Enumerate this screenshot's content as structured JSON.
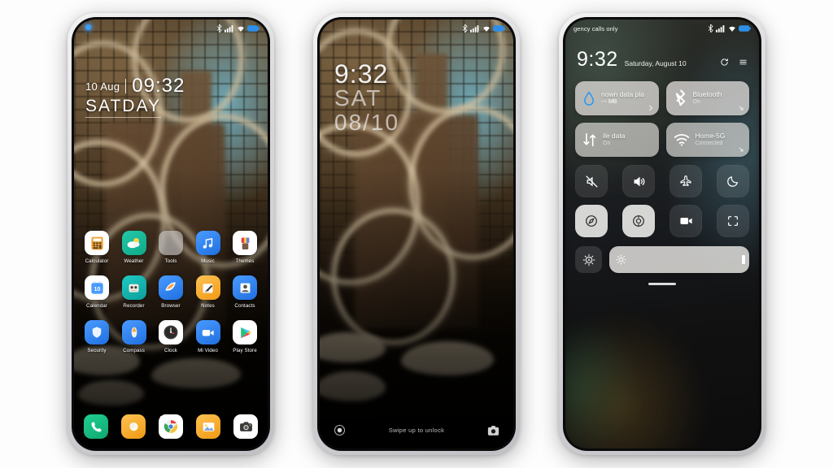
{
  "scene": {
    "background_color": "#ffffff",
    "phone_count": 3
  },
  "phone1_home": {
    "status_bar": {
      "left_text": "",
      "icons": [
        "bluetooth-icon",
        "signal-icon",
        "wifi-icon",
        "battery-icon"
      ]
    },
    "clock_widget": {
      "date": "10 Aug",
      "time": "09:32",
      "day": "SATDAY"
    },
    "app_rows": [
      [
        {
          "label": "Calculator",
          "icon": "calculator-icon",
          "bg": "#ffffff"
        },
        {
          "label": "Weather",
          "icon": "weather-icon",
          "bg": "#18b89a"
        },
        {
          "label": "Tools",
          "icon": "folder-icon",
          "bg": "#cdcdcd"
        },
        {
          "label": "Music",
          "icon": "music-icon",
          "bg": "#2e7ff0"
        },
        {
          "label": "Themes",
          "icon": "themes-icon",
          "bg": "#ffffff"
        }
      ],
      [
        {
          "label": "Calendar",
          "icon": "calendar-icon",
          "bg": "#ffffff"
        },
        {
          "label": "Recorder",
          "icon": "recorder-icon",
          "bg": "#15b7b0"
        },
        {
          "label": "Browser",
          "icon": "browser-icon",
          "bg": "#2e7ff0"
        },
        {
          "label": "Notes",
          "icon": "notes-icon",
          "bg": "#f5a623"
        },
        {
          "label": "Contacts",
          "icon": "contacts-icon",
          "bg": "#2e7ff0"
        }
      ],
      [
        {
          "label": "Security",
          "icon": "shield-icon",
          "bg": "#2e7ff0"
        },
        {
          "label": "Compass",
          "icon": "compass-icon",
          "bg": "#2e7ff0"
        },
        {
          "label": "Clock",
          "icon": "clock-icon",
          "bg": "#ffffff"
        },
        {
          "label": "Mi Video",
          "icon": "video-icon",
          "bg": "#2e7ff0"
        },
        {
          "label": "Play Store",
          "icon": "play-store-icon",
          "bg": "#ffffff"
        }
      ]
    ],
    "page_dots": {
      "count": 3,
      "active_index": 0
    },
    "dock": [
      {
        "label": "Phone",
        "icon": "phone-icon",
        "bg": "#17b980"
      },
      {
        "label": "Messages",
        "icon": "messages-icon",
        "bg": "#f5a623"
      },
      {
        "label": "Chrome",
        "icon": "chrome-icon",
        "bg": "#ffffff"
      },
      {
        "label": "Gallery",
        "icon": "gallery-icon",
        "bg": "#f5a623"
      },
      {
        "label": "Camera",
        "icon": "camera-icon",
        "bg": "#ffffff"
      }
    ]
  },
  "phone2_lock": {
    "status_bar": {
      "icons": [
        "bluetooth-icon",
        "signal-icon",
        "wifi-icon",
        "battery-icon"
      ]
    },
    "clock": {
      "time": "9:32",
      "day": "SAT",
      "date": "08/10"
    },
    "bottom": {
      "left_icon": "record-circle-icon",
      "hint": "Swipe up to unlock",
      "right_icon": "camera-icon"
    }
  },
  "phone3_control_center": {
    "status_bar": {
      "carrier": "gency calls only",
      "icons": [
        "bluetooth-icon",
        "signal-icon",
        "wifi-icon",
        "battery-icon"
      ]
    },
    "header": {
      "time": "9:32",
      "date": "Saturday, August 10",
      "refresh_icon": "refresh-icon",
      "menu_icon": "menu-icon"
    },
    "big_tiles": [
      {
        "icon": "data-drop-icon",
        "title": "nown data pla",
        "subtitle": "--- MB",
        "accent": "#2196f3",
        "expand": "chevron-right-icon"
      },
      {
        "icon": "bluetooth-icon",
        "title": "Bluetooth",
        "subtitle": "On",
        "accent": "#ffffff",
        "expand": "expand-arrow-icon"
      }
    ],
    "mid_tiles": [
      {
        "icon": "mobile-data-icon",
        "title": "ile data",
        "subtitle": "On",
        "accent": "#ffffff",
        "expand": ""
      },
      {
        "icon": "wifi-icon",
        "title": "Home-5G",
        "subtitle": "Connected",
        "accent": "#ffffff",
        "expand": "expand-arrow-icon"
      }
    ],
    "toggle_rows": [
      [
        {
          "name": "silent-icon",
          "active": false
        },
        {
          "name": "sound-icon",
          "active": false
        },
        {
          "name": "airplane-icon",
          "active": false
        },
        {
          "name": "dark-mode-icon",
          "active": false
        }
      ],
      [
        {
          "name": "location-icon",
          "active": true
        },
        {
          "name": "auto-rotate-icon",
          "active": true
        },
        {
          "name": "screen-recorder-icon",
          "active": false
        },
        {
          "name": "screenshot-icon",
          "active": false
        }
      ]
    ],
    "brightness": {
      "auto_icon": "auto-brightness-icon",
      "slider_icon": "brightness-icon",
      "value_percent": 96
    },
    "handle": "drag-handle"
  }
}
